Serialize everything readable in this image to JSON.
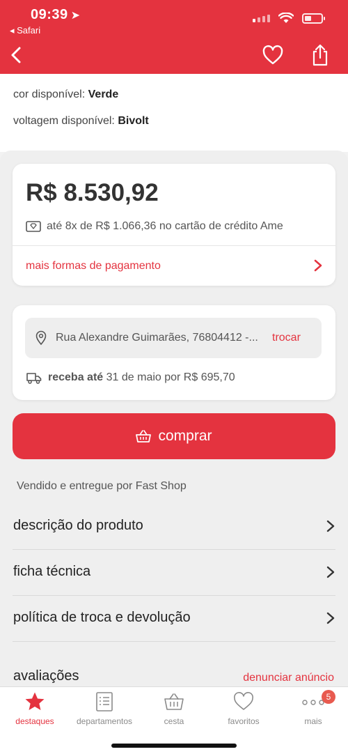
{
  "status": {
    "time": "09:39",
    "back_app": "◂ Safari"
  },
  "product_options": {
    "color_label": "cor disponível:",
    "color_value": "Verde",
    "voltage_label": "voltagem disponível:",
    "voltage_value": "Bivolt"
  },
  "price_card": {
    "price": "R$ 8.530,92",
    "installments": "até 8x de R$ 1.066,36 no cartão de crédito Ame",
    "payment_link": "mais formas de pagamento"
  },
  "delivery_card": {
    "address": "Rua Alexandre Guimarães, 76804412 -...",
    "change_label": "trocar",
    "shipping_bold": "receba até",
    "shipping_rest": "31 de maio por R$ 695,70"
  },
  "buy_button": {
    "label": "comprar"
  },
  "seller": "Vendido e entregue por Fast Shop",
  "sections": [
    {
      "label": "descrição do produto"
    },
    {
      "label": "ficha técnica"
    },
    {
      "label": "política de troca e devolução"
    }
  ],
  "reviews": {
    "title": "avaliações",
    "report_link": "denunciar anúncio"
  },
  "tabbar": {
    "tabs": [
      {
        "label": "destaques",
        "icon": "star-icon"
      },
      {
        "label": "departamentos",
        "icon": "list-icon"
      },
      {
        "label": "cesta",
        "icon": "basket-icon"
      },
      {
        "label": "favoritos",
        "icon": "heart-icon"
      },
      {
        "label": "mais",
        "icon": "more-icon",
        "badge": "5"
      }
    ]
  },
  "colors": {
    "brand": "#e4333f",
    "background": "#efefef"
  }
}
